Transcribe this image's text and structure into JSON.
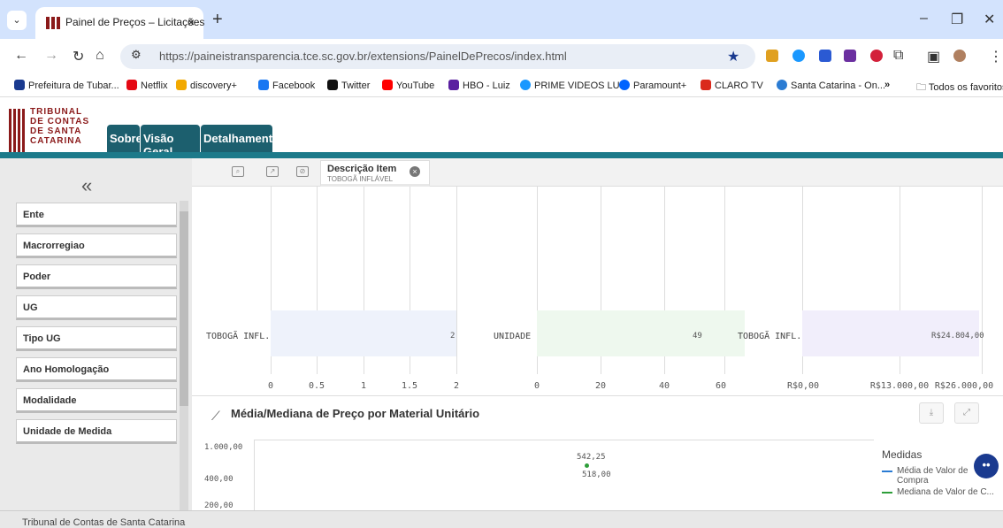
{
  "browser": {
    "tab_title": "Painel de Preços – Licitações",
    "url": "https://paineistransparencia.tce.sc.gov.br/extensions/PainelDePrecos/index.html"
  },
  "bookmarks": [
    {
      "label": "Prefeitura de Tubar...",
      "color": "#1a3a8f"
    },
    {
      "label": "Netflix",
      "color": "#e50914"
    },
    {
      "label": "discovery+",
      "color": "#f2a900"
    },
    {
      "label": "Facebook",
      "color": "#1877f2"
    },
    {
      "label": "Twitter",
      "color": "#111111"
    },
    {
      "label": "YouTube",
      "color": "#ff0000"
    },
    {
      "label": "HBO - Luiz",
      "color": "#5a1fa0"
    },
    {
      "label": "PRIME VIDEOS LUIZ",
      "color": "#1a98ff"
    },
    {
      "label": "Paramount+",
      "color": "#0064ff"
    },
    {
      "label": "CLARO TV",
      "color": "#da291c"
    },
    {
      "label": "Santa Catarina - On...",
      "color": "#2b7cd3"
    }
  ],
  "bookmarks_overflow": "»",
  "bookmarks_all": "Todos os favoritos",
  "logo": {
    "line1": "TRIBUNAL",
    "line2": "DE CONTAS",
    "line3": "DE SANTA",
    "line4": "CATARINA"
  },
  "nav": {
    "sobre": "Sobre",
    "visao_geral": "Visão Geral",
    "detalhamento": "Detalhamento"
  },
  "sidebar": {
    "collapse": "«",
    "filters": [
      "Ente",
      "Macrorregiao",
      "Poder",
      "UG",
      "Tipo UG",
      "Ano Homologação",
      "Modalidade",
      "Unidade de Medida"
    ]
  },
  "selection": {
    "field": "Descrição Item",
    "value": "TOBOGÃ INFLÁVEL"
  },
  "chart_data": [
    {
      "type": "bar",
      "orientation": "horizontal",
      "categories": [
        "TOBOGÃ INFL..."
      ],
      "values": [
        2
      ],
      "value_labels": [
        "2"
      ],
      "xlim": [
        0,
        2
      ],
      "x_ticks": [
        "0",
        "0.5",
        "1",
        "1.5",
        "2"
      ],
      "color": "#eef2fb"
    },
    {
      "type": "bar",
      "orientation": "horizontal",
      "categories": [
        "UNIDADE"
      ],
      "values": [
        49
      ],
      "value_labels": [
        "49"
      ],
      "xlim": [
        0,
        60
      ],
      "x_ticks": [
        "0",
        "20",
        "40",
        "60"
      ],
      "color": "#eef8ee"
    },
    {
      "type": "bar",
      "orientation": "horizontal",
      "categories": [
        "TOBOGÃ INFL..."
      ],
      "values": [
        24804
      ],
      "value_labels": [
        "R$24.804,00"
      ],
      "xlim": [
        0,
        26000
      ],
      "x_ticks": [
        "R$0,00",
        "R$13.000,00",
        "R$26.000,00"
      ],
      "color": "#f1eefb"
    },
    {
      "type": "line",
      "title": "Média/Mediana de Preço por Material Unitário",
      "y_ticks": [
        "1.000,00",
        "400,00",
        "200,00"
      ],
      "series": [
        {
          "name": "Média de Valor de Compra",
          "values": [
            542.25
          ],
          "value_labels": [
            "542,25"
          ],
          "color": "#2a7bd3"
        },
        {
          "name": "Mediana de Valor de C...",
          "values": [
            518.0
          ],
          "value_labels": [
            "518,00"
          ],
          "color": "#2e9e3a"
        }
      ],
      "legend_title": "Medidas",
      "legend_position": "right"
    }
  ],
  "footer": "Tribunal de Contas de Santa Catarina"
}
